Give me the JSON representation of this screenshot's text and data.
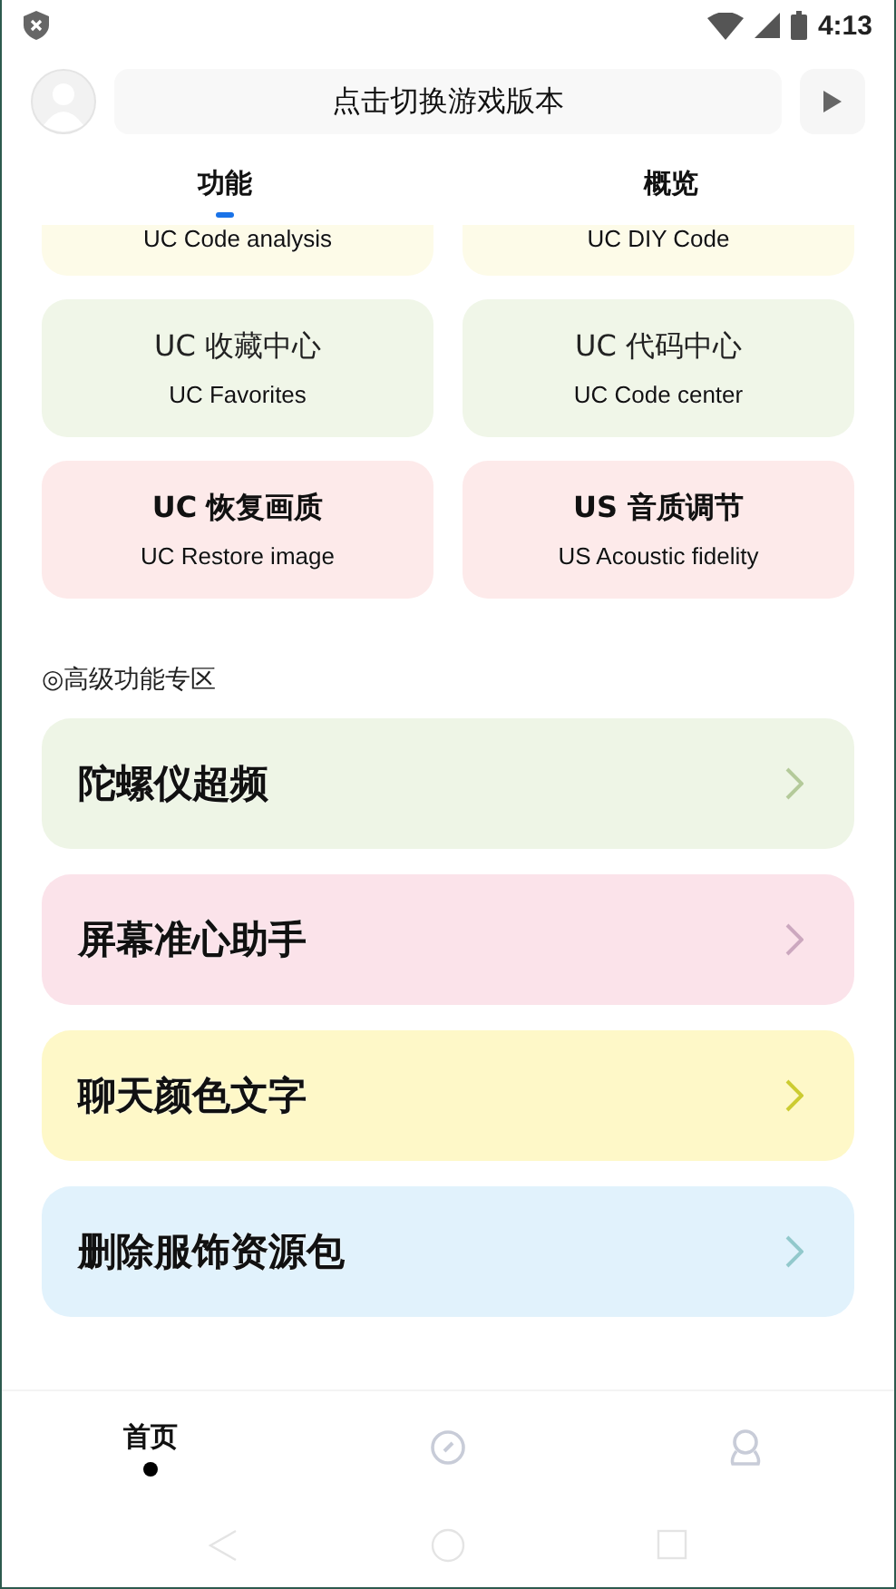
{
  "status_bar": {
    "time": "4:13"
  },
  "header": {
    "version_button": "点击切换游戏版本"
  },
  "tabs": [
    {
      "label": "功能",
      "selected": true
    },
    {
      "label": "概览",
      "selected": false
    }
  ],
  "cards": [
    {
      "kind": "cut",
      "subtitle": "UC Code analysis",
      "color": "#fdfbe8"
    },
    {
      "kind": "cut",
      "subtitle": "UC DIY Code",
      "color": "#fdfbe8"
    },
    {
      "kind": "plain",
      "title": "UC 收藏中心",
      "subtitle": "UC Favorites",
      "color": "#f0f6e8"
    },
    {
      "kind": "plain",
      "title": "UC 代码中心",
      "subtitle": "UC Code center",
      "color": "#f0f6e8"
    },
    {
      "kind": "bold",
      "title": "UC 恢复画质",
      "subtitle": "UC Restore image",
      "color": "#fdeaea"
    },
    {
      "kind": "bold",
      "title": "US 音质调节",
      "subtitle": "US Acoustic fidelity",
      "color": "#fdeaea"
    }
  ],
  "section_title": "◎高级功能专区",
  "features": [
    {
      "label": "陀螺仪超频",
      "color": "#eef5e6"
    },
    {
      "label": "屏幕准心助手",
      "color": "#fbe3ea"
    },
    {
      "label": "聊天颜色文字",
      "color": "#fef8c8"
    },
    {
      "label": "删除服饰资源包",
      "color": "#e1f2fc"
    }
  ],
  "bottom_nav": [
    {
      "kind": "text",
      "label": "首页",
      "selected": true
    },
    {
      "kind": "compass",
      "selected": false
    },
    {
      "kind": "person",
      "selected": false
    }
  ]
}
